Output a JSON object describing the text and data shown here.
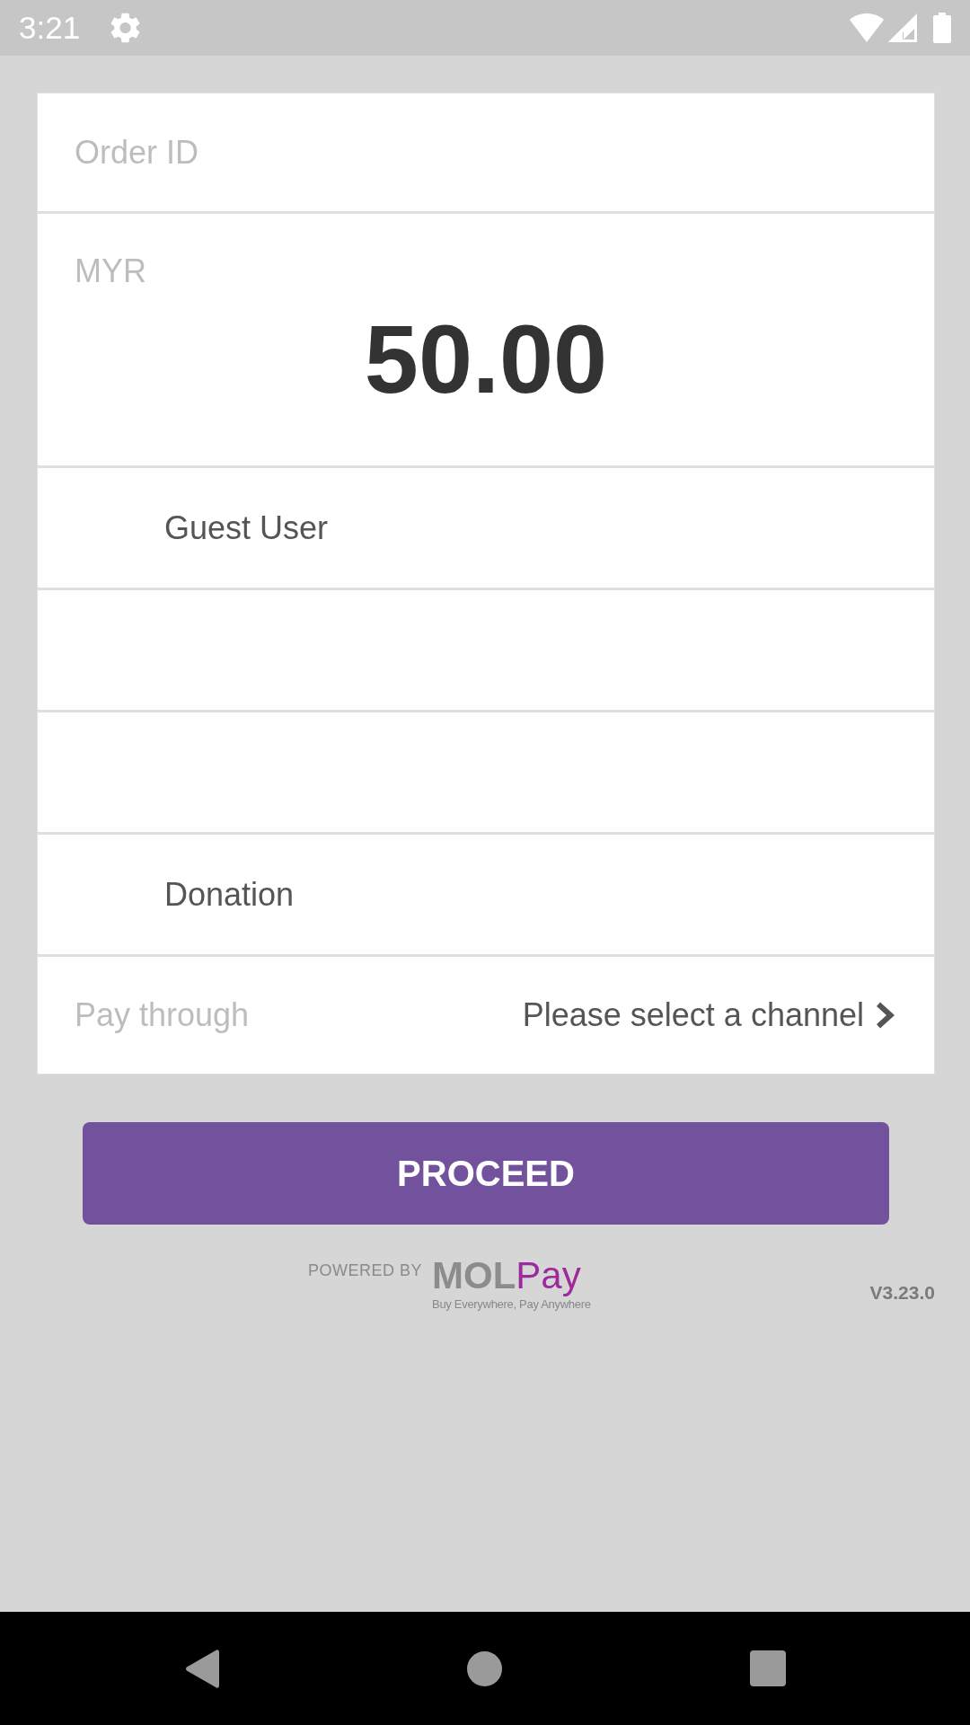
{
  "status_bar": {
    "time": "3:21"
  },
  "form": {
    "rows": [
      {
        "kind": "input",
        "placeholder": "Order ID"
      },
      {
        "kind": "amount",
        "currency": "MYR",
        "amount": "50.00"
      },
      {
        "kind": "indented",
        "value": "Guest User"
      },
      {
        "kind": "indented"
      },
      {
        "kind": "indented"
      },
      {
        "kind": "indented",
        "value": "Donation"
      },
      {
        "kind": "select",
        "label": "Pay through",
        "value": "Please select a channel"
      }
    ]
  },
  "proceed_button": {
    "label": "PROCEED"
  },
  "footer": {
    "powered_by": "POWERED BY",
    "logo": {
      "parts": [
        "MOL",
        "Pay"
      ],
      "tagline": "Buy Everywhere, Pay Anywhere"
    },
    "version": "V3.23.0"
  }
}
